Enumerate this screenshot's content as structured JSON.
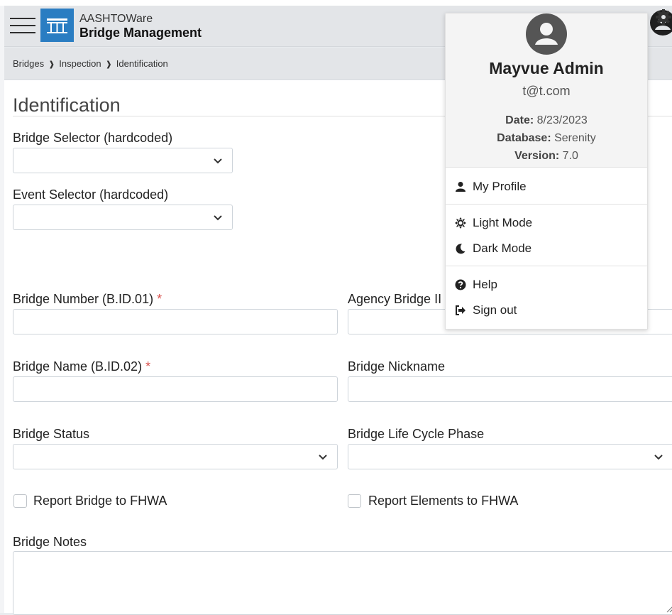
{
  "header": {
    "app_name_line1": "AASHTOWare",
    "app_name_line2": "Bridge Management"
  },
  "breadcrumb": {
    "items": [
      "Bridges",
      "Inspection",
      "Identification"
    ],
    "separator": "❱"
  },
  "page": {
    "title": "Identification"
  },
  "form": {
    "bridge_selector_label": "Bridge Selector (hardcoded)",
    "event_selector_label": "Event Selector (hardcoded)",
    "bridge_number_label": "Bridge Number (B.ID.01)",
    "agency_bridge_label": "Agency Bridge II",
    "bridge_name_label": "Bridge Name (B.ID.02)",
    "bridge_nickname_label": "Bridge Nickname",
    "bridge_status_label": "Bridge Status",
    "life_cycle_label": "Bridge Life Cycle Phase",
    "report_bridge_label": "Report Bridge to FHWA",
    "report_elements_label": "Report Elements to FHWA",
    "bridge_notes_label": "Bridge Notes",
    "required_marker": "*"
  },
  "user_menu": {
    "name": "Mayvue Admin",
    "email": "t@t.com",
    "date_label": "Date:",
    "date_value": "8/23/2023",
    "database_label": "Database:",
    "database_value": "Serenity",
    "version_label": "Version:",
    "version_value": "7.0",
    "items": {
      "my_profile": "My Profile",
      "light_mode": "Light Mode",
      "dark_mode": "Dark Mode",
      "help": "Help",
      "sign_out": "Sign out"
    }
  },
  "icons": {
    "hamburger": "menu-icon",
    "logo": "bridge-logo-icon",
    "user": "user-circle-icon",
    "settings": "gear-icon",
    "profile": "user-icon",
    "light": "sun-icon",
    "dark": "moon-icon",
    "help": "question-circle-icon",
    "signout": "sign-out-icon"
  },
  "colors": {
    "brand_blue": "#2a7dc2",
    "required_red": "#d9534f",
    "header_bg": "#e3e5e8"
  }
}
